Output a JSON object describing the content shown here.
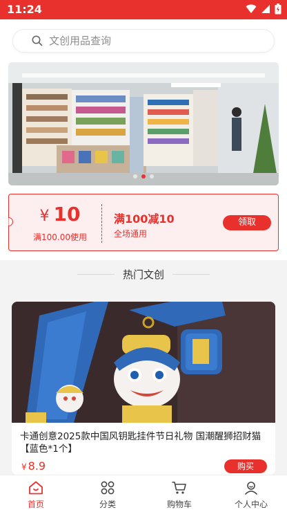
{
  "status_bar": {
    "time": "11:24"
  },
  "search": {
    "placeholder": "文创用品查询"
  },
  "coupon": {
    "currency": "¥",
    "amount": "10",
    "condition": "满100.00使用",
    "title": "满100减10",
    "scope": "全场通用",
    "claim_label": "领取"
  },
  "section": {
    "title": "热门文创"
  },
  "product": {
    "name": "卡通创意2025款中国风钥匙挂件节日礼物 国潮醒狮招财猫【蓝色*1个】",
    "currency": "¥",
    "price": "8.9",
    "buy_label": "购买"
  },
  "tabbar": {
    "items": [
      {
        "label": "首页",
        "icon": "home-icon",
        "active": true
      },
      {
        "label": "分类",
        "icon": "category-icon",
        "active": false
      },
      {
        "label": "购物车",
        "icon": "cart-icon",
        "active": false
      },
      {
        "label": "个人中心",
        "icon": "profile-icon",
        "active": false
      }
    ]
  },
  "colors": {
    "accent": "#e8312c",
    "coupon_bg": "#fdeff0",
    "page_bg": "#f3f3f3"
  }
}
